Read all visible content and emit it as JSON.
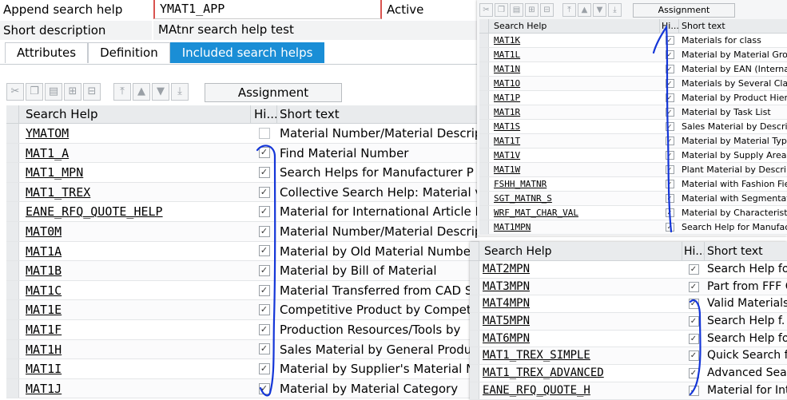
{
  "header": {
    "append_label": "Append search help",
    "append_value": "YMAT1_APP",
    "status": "Active",
    "shortdesc_label": "Short description",
    "shortdesc_value": "MAtnr search help test"
  },
  "tabs": [
    {
      "label": "Attributes"
    },
    {
      "label": "Definition"
    },
    {
      "label": "Included search helps",
      "active": true
    }
  ],
  "toolbar": {
    "assignment_label": "Assignment"
  },
  "columns": {
    "search_help": "Search Help",
    "hidden": "Hi...",
    "short_text": "Short text"
  },
  "main_rows": [
    {
      "name": "YMATOM",
      "hidden": false,
      "text": "Material Number/Material Descrip"
    },
    {
      "name": "MAT1_A",
      "hidden": true,
      "text": "Find Material Number"
    },
    {
      "name": "MAT1_MPN",
      "hidden": true,
      "text": "Search Helps for Manufacturer P"
    },
    {
      "name": "MAT1_TREX",
      "hidden": true,
      "text": "Collective Search Help: Material v"
    },
    {
      "name": "EANE_RFQ_QUOTE_HELP",
      "hidden": true,
      "text": "Material for International Article I"
    },
    {
      "name": "MAT0M",
      "hidden": true,
      "text": "Material Number/Material Descrip"
    },
    {
      "name": "MAT1A",
      "hidden": true,
      "text": "Material by Old Material Number"
    },
    {
      "name": "MAT1B",
      "hidden": true,
      "text": "Material by Bill of Material"
    },
    {
      "name": "MAT1C",
      "hidden": true,
      "text": "Material Transferred from CAD S"
    },
    {
      "name": "MAT1E",
      "hidden": true,
      "text": "Competitive Product by Compet"
    },
    {
      "name": "MAT1F",
      "hidden": true,
      "text": "Production Resources/Tools by"
    },
    {
      "name": "MAT1H",
      "hidden": true,
      "text": "Sales Material by General Produ"
    },
    {
      "name": "MAT1I",
      "hidden": true,
      "text": "Material by Supplier's Material N"
    },
    {
      "name": "MAT1J",
      "hidden": true,
      "text": "Material by Material Category"
    }
  ],
  "right_top": {
    "assignment_label": "Assignment",
    "columns": {
      "search_help": "Search Help",
      "hidden": "Hi...",
      "short_text": "Short text"
    },
    "rows": [
      {
        "name": "MAT1K",
        "hidden": true,
        "text": "Materials for class"
      },
      {
        "name": "MAT1L",
        "hidden": true,
        "text": "Material by Material Grou"
      },
      {
        "name": "MAT1N",
        "hidden": true,
        "text": "Material by EAN (Internat"
      },
      {
        "name": "MAT1O",
        "hidden": true,
        "text": "Materials by Several Clas"
      },
      {
        "name": "MAT1P",
        "hidden": true,
        "text": "Material by Product Hiera"
      },
      {
        "name": "MAT1R",
        "hidden": true,
        "text": "Material by Task List"
      },
      {
        "name": "MAT1S",
        "hidden": true,
        "text": "Sales Material by Descrip"
      },
      {
        "name": "MAT1T",
        "hidden": true,
        "text": "Material by Material Type"
      },
      {
        "name": "MAT1V",
        "hidden": true,
        "text": "Material by Supply Area"
      },
      {
        "name": "MAT1W",
        "hidden": true,
        "text": "Plant Material by Descrip"
      },
      {
        "name": "FSHH_MATNR",
        "hidden": true,
        "text": "Material with Fashion Fie"
      },
      {
        "name": "SGT_MATNR_S",
        "hidden": true,
        "text": "Material with Segmentati"
      },
      {
        "name": "WRF_MAT_CHAR_VAL",
        "hidden": true,
        "text": "Material by Characteristi"
      },
      {
        "name": "MAT1MPN",
        "hidden": true,
        "text": "Search Help for Manufac"
      }
    ]
  },
  "right_bottom": {
    "columns": {
      "search_help": "Search Help",
      "hidden": "Hi...",
      "short_text": "Short text"
    },
    "rows": [
      {
        "name": "MAT2MPN",
        "hidden": true,
        "text": "Search Help for"
      },
      {
        "name": "MAT3MPN",
        "hidden": true,
        "text": "Part from FFF C"
      },
      {
        "name": "MAT4MPN",
        "hidden": true,
        "text": "Valid Materials"
      },
      {
        "name": "MAT5MPN",
        "hidden": true,
        "text": "Search Help f."
      },
      {
        "name": "MAT6MPN",
        "hidden": true,
        "text": "Search Help for"
      },
      {
        "name": "MAT1_TREX_SIMPLE",
        "hidden": true,
        "text": "Quick Search fo"
      },
      {
        "name": "MAT1_TREX_ADVANCED",
        "hidden": true,
        "text": "Advanced Sear"
      },
      {
        "name": "EANE_RFQ_QUOTE_H",
        "hidden": true,
        "text": "Material for Inte"
      }
    ]
  },
  "colors": {
    "accent": "#1a8ed6",
    "annotation": "#1436d8",
    "required": "#d9534f",
    "header_bg": "#e9ebed"
  },
  "icons": [
    "cut-icon",
    "copy-icon",
    "paste-icon",
    "insert-row-icon",
    "delete-row-icon",
    "move-top-icon",
    "move-up-icon",
    "move-down-icon",
    "move-bottom-icon"
  ]
}
